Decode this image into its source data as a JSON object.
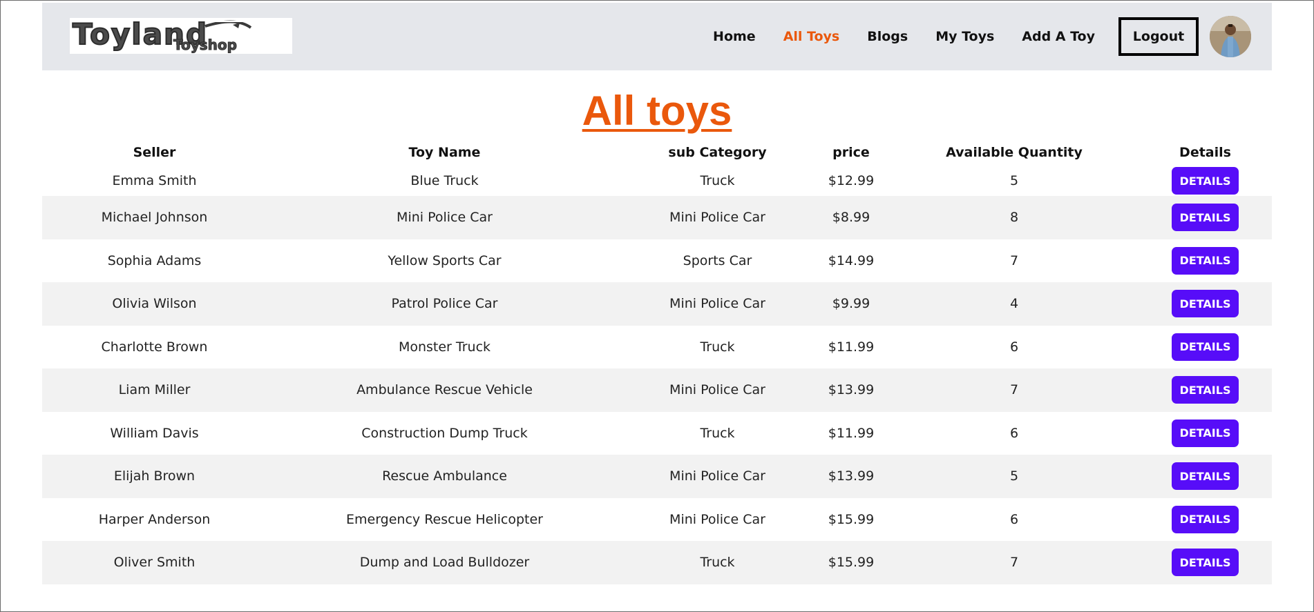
{
  "logo": {
    "line1": "Toyland",
    "line2": "Toyshop"
  },
  "nav": {
    "links": [
      "Home",
      "All Toys",
      "Blogs",
      "My Toys",
      "Add A Toy"
    ],
    "active": "All Toys",
    "logout_label": "Logout"
  },
  "page_title": "All toys",
  "table": {
    "headers": [
      "Seller",
      "Toy Name",
      "sub Category",
      "price",
      "Available Quantity",
      "Details"
    ],
    "rows": [
      {
        "seller": "Emma Smith",
        "toy_name": "Blue Truck",
        "sub_category": "Truck",
        "price": "$12.99",
        "quantity": "5",
        "action": "DETAILS"
      },
      {
        "seller": "Michael Johnson",
        "toy_name": "Mini Police Car",
        "sub_category": "Mini Police Car",
        "price": "$8.99",
        "quantity": "8",
        "action": "DETAILS"
      },
      {
        "seller": "Sophia Adams",
        "toy_name": "Yellow Sports Car",
        "sub_category": "Sports Car",
        "price": "$14.99",
        "quantity": "7",
        "action": "DETAILS"
      },
      {
        "seller": "Olivia Wilson",
        "toy_name": "Patrol Police Car",
        "sub_category": "Mini Police Car",
        "price": "$9.99",
        "quantity": "4",
        "action": "DETAILS"
      },
      {
        "seller": "Charlotte Brown",
        "toy_name": "Monster Truck",
        "sub_category": "Truck",
        "price": "$11.99",
        "quantity": "6",
        "action": "DETAILS"
      },
      {
        "seller": "Liam Miller",
        "toy_name": "Ambulance Rescue Vehicle",
        "sub_category": "Mini Police Car",
        "price": "$13.99",
        "quantity": "7",
        "action": "DETAILS"
      },
      {
        "seller": "William Davis",
        "toy_name": "Construction Dump Truck",
        "sub_category": "Truck",
        "price": "$11.99",
        "quantity": "6",
        "action": "DETAILS"
      },
      {
        "seller": "Elijah Brown",
        "toy_name": "Rescue Ambulance",
        "sub_category": "Mini Police Car",
        "price": "$13.99",
        "quantity": "5",
        "action": "DETAILS"
      },
      {
        "seller": "Harper Anderson",
        "toy_name": "Emergency Rescue Helicopter",
        "sub_category": "Mini Police Car",
        "price": "$15.99",
        "quantity": "6",
        "action": "DETAILS"
      },
      {
        "seller": "Oliver Smith",
        "toy_name": "Dump and Load Bulldozer",
        "sub_category": "Truck",
        "price": "$15.99",
        "quantity": "7",
        "action": "DETAILS"
      }
    ]
  },
  "colors": {
    "accent": "#ea580c",
    "button": "#570df8",
    "navbar_bg": "#e5e7eb",
    "row_stripe": "#f2f2f2"
  },
  "icons": {
    "avatar": "user-avatar-photo"
  }
}
